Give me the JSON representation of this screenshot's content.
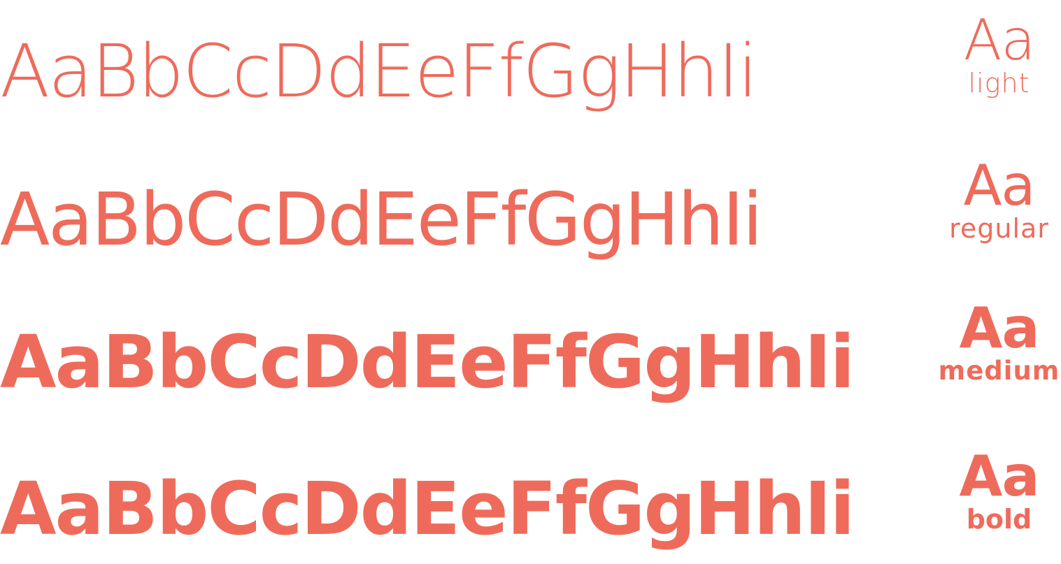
{
  "colors": {
    "accent": "#ee6b5b",
    "background": "#ffffff"
  },
  "rows": [
    {
      "weight": "light",
      "alphabet": "AaBbCcDdEeFfGgHhIi",
      "sample": "Aa",
      "label": "light"
    },
    {
      "weight": "regular",
      "alphabet": "AaBbCcDdEeFfGgHhIi",
      "sample": "Aa",
      "label": "regular"
    },
    {
      "weight": "medium",
      "alphabet": "AaBbCcDdEeFfGgHhIi",
      "sample": "Aa",
      "label": "medium"
    },
    {
      "weight": "bold",
      "alphabet": "AaBbCcDdEeFfGgHhIi",
      "sample": "Aa",
      "label": "bold"
    }
  ]
}
